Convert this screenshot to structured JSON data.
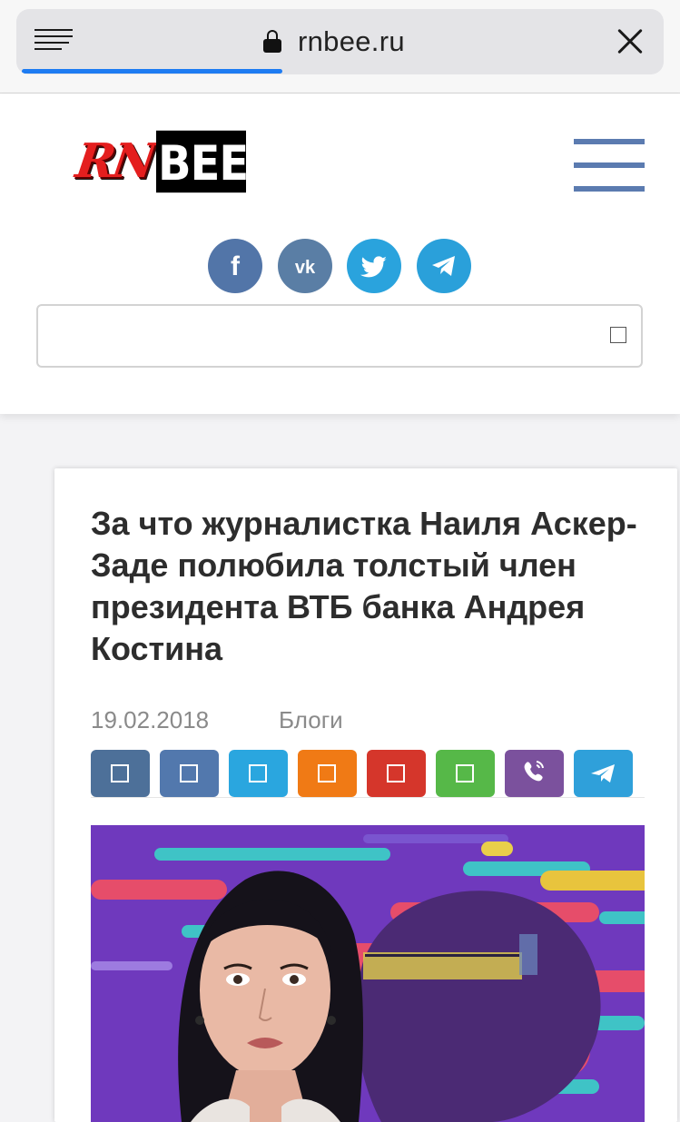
{
  "browser": {
    "url": "rnbee.ru",
    "load_progress": 0.41
  },
  "header": {
    "logo": {
      "part1": "RN",
      "part2": "BEE"
    },
    "social": [
      {
        "network": "facebook",
        "glyph": "f",
        "color": "#5275a8"
      },
      {
        "network": "vk",
        "glyph": "вк",
        "color": "#5a7ea5"
      },
      {
        "network": "twitter",
        "glyph": "🐦",
        "color": "#2aa3dd"
      },
      {
        "network": "telegram",
        "glyph": "➤",
        "color": "#2aa0da"
      }
    ],
    "search": {
      "placeholder": "",
      "icon": "☐"
    }
  },
  "article": {
    "title": "За что журналистка Наиля Аскер-Заде полюбила толстый член президента ВТБ банка Андрея Костина",
    "date": "19.02.2018",
    "category": "Блоги",
    "share_buttons": [
      {
        "name": "share-button-1",
        "icon": "☐",
        "color": "#4d7099"
      },
      {
        "name": "share-button-2",
        "icon": "☐",
        "color": "#5278ad"
      },
      {
        "name": "share-button-3",
        "icon": "☐",
        "color": "#2aa6df"
      },
      {
        "name": "share-button-4",
        "icon": "☐",
        "color": "#f07a15"
      },
      {
        "name": "share-button-5",
        "icon": "☐",
        "color": "#d5362b"
      },
      {
        "name": "share-button-6",
        "icon": "☐",
        "color": "#56b848"
      },
      {
        "name": "share-viber",
        "icon": "viber-icon",
        "color": "#7b519d"
      },
      {
        "name": "share-telegram",
        "icon": "telegram-icon",
        "color": "#2fa0da"
      }
    ]
  }
}
